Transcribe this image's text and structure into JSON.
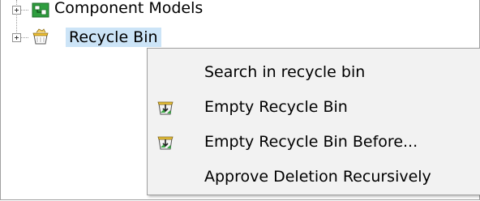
{
  "tree": {
    "items": [
      {
        "label": "Component Models",
        "icon": "component-models-icon"
      },
      {
        "label": "Recycle Bin",
        "icon": "recycle-bin-icon",
        "selected": true
      }
    ]
  },
  "context_menu": {
    "items": [
      {
        "label": "Search in recycle bin",
        "icon": null
      },
      {
        "label": "Empty Recycle Bin",
        "icon": "empty-bin-icon"
      },
      {
        "label": "Empty Recycle Bin Before...",
        "icon": "empty-bin-icon"
      },
      {
        "label": "Approve Deletion Recursively",
        "icon": null
      }
    ]
  },
  "colors": {
    "selection": "#cce4f7",
    "menu_background": "#f2f2f2",
    "border": "#a0a0a0"
  }
}
